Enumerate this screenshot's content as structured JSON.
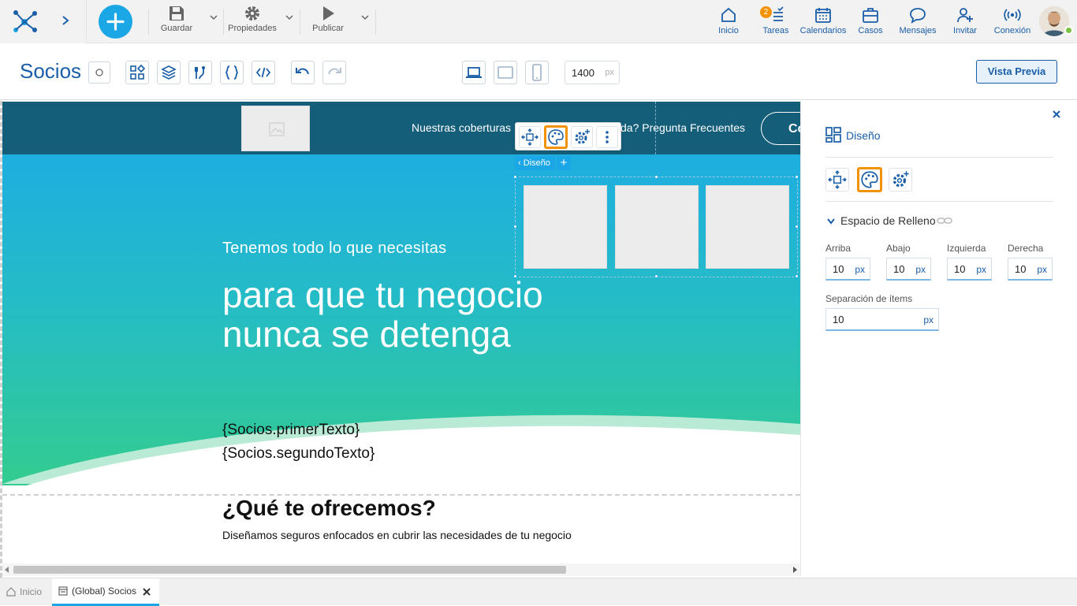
{
  "topbar": {
    "guardar": "Guardar",
    "propiedades": "Propiedades",
    "publicar": "Publicar",
    "nav": [
      {
        "label": "Inicio",
        "icon": "home-icon"
      },
      {
        "label": "Tareas",
        "icon": "tasks-icon",
        "badge": "2"
      },
      {
        "label": "Calendarios",
        "icon": "calendar-icon"
      },
      {
        "label": "Casos",
        "icon": "briefcase-icon"
      },
      {
        "label": "Mensajes",
        "icon": "chat-icon"
      },
      {
        "label": "Invitar",
        "icon": "invite-user-icon"
      },
      {
        "label": "Conexión",
        "icon": "connection-icon"
      }
    ],
    "accent": "#1ba7e6"
  },
  "toolbar": {
    "page_title": "Socios",
    "width_value": "1400",
    "width_unit": "px",
    "preview_label": "Vista Previa"
  },
  "canvas": {
    "header_link_1": "Nuestras coberturas",
    "header_link_2": "da? Pregunta Frecuentes",
    "header_button": "Co",
    "hero_kicker": "Tenemos todo lo que necesitas",
    "hero_title_1": "para que tu negocio",
    "hero_title_2": "nunca se detenga",
    "text_1": "{Socios.primerTexto}",
    "text_2": "{Socios.segundoTexto}",
    "section_title": "¿Qué te ofrecemos?",
    "section_sub": "Diseñamos seguros enfocados en cubrir las necesidades de tu negocio",
    "breadcrumb": "Diseño",
    "header_color": "#145e7a",
    "hero_top_color": "#1eaee0",
    "hero_bottom_color": "#33cc8f"
  },
  "panel": {
    "title": "Diseño",
    "section": "Espacio de Relleno",
    "fields": [
      {
        "label": "Arriba",
        "value": "10",
        "unit": "px"
      },
      {
        "label": "Abajo",
        "value": "10",
        "unit": "px"
      },
      {
        "label": "Izquierda",
        "value": "10",
        "unit": "px"
      },
      {
        "label": "Derecha",
        "value": "10",
        "unit": "px"
      }
    ],
    "gap_label": "Separación de ítems",
    "gap_value": "10",
    "gap_unit": "px",
    "highlight_color": "#f39200"
  },
  "tabs": {
    "home": "Inicio",
    "active": "(Global) Socios"
  }
}
